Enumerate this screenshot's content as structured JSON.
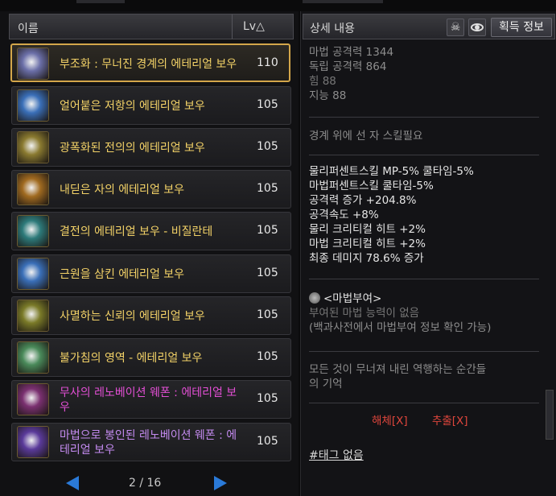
{
  "list": {
    "header_name": "이름",
    "header_lv": "Lv△",
    "items": [
      {
        "name": "부조화 : 무너진 경계의 에테리얼 보우",
        "lv": "110",
        "color": "#f3d267",
        "icon": "bow-purple-icon",
        "icon_bg": "#6b6fa8",
        "selected": true
      },
      {
        "name": "얼어붙은 저항의 에테리얼 보우",
        "lv": "105",
        "color": "#f3d267",
        "icon": "bow-blue-icon",
        "icon_bg": "#3a6fb8"
      },
      {
        "name": "광폭화된 전의의 에테리얼 보우",
        "lv": "105",
        "color": "#f3d267",
        "icon": "bow-gold-icon",
        "icon_bg": "#8a7a30"
      },
      {
        "name": "내딛은 자의 에테리얼 보우",
        "lv": "105",
        "color": "#f3d267",
        "icon": "bow-orange-icon",
        "icon_bg": "#a06a20"
      },
      {
        "name": "결전의 에테리얼 보우 - 비질란테",
        "lv": "105",
        "color": "#f3d267",
        "icon": "bow-teal-icon",
        "icon_bg": "#2d7a7a"
      },
      {
        "name": "근원을 삼킨 에테리얼 보우",
        "lv": "105",
        "color": "#f3d267",
        "icon": "bow-blue-icon",
        "icon_bg": "#3a6fb8"
      },
      {
        "name": "사멸하는 신뢰의 에테리얼 보우",
        "lv": "105",
        "color": "#f3d267",
        "icon": "bow-gold-icon",
        "icon_bg": "#7a7a28"
      },
      {
        "name": "불가침의 영역 - 에테리얼 보우",
        "lv": "105",
        "color": "#f3d267",
        "icon": "bow-green-icon",
        "icon_bg": "#4a8a5a"
      },
      {
        "name": "무사의 레노베이션 웨폰 : 에테리얼 보우",
        "lv": "105",
        "color": "#e34fd5",
        "icon": "bow-crimson-icon",
        "icon_bg": "#7a3070"
      },
      {
        "name": "마법으로 봉인된 레노베이션 웨폰 : 에테리얼 보우",
        "lv": "105",
        "color": "#c48bf0",
        "icon": "sealed-box-icon",
        "icon_bg": "#5a3a9a"
      }
    ]
  },
  "pager": {
    "text": "2 / 16"
  },
  "detail": {
    "title": "상세 내용",
    "acquire_label": "획득 정보",
    "skull_glyph": "☠",
    "stats": [
      "마법 공격력 1344",
      "독립 공격력 864",
      "힘 88",
      "지능 88"
    ],
    "requirement": "경계 위에 선 자 스킬필요",
    "options": [
      "물리퍼센트스킬 MP-5% 쿨타임-5%",
      "마법퍼센트스킬 쿨타임-5%",
      "공격력 증가 +204.8%",
      "공격속도 +8%",
      "물리 크리티컬 히트 +2%",
      "마법 크리티컬 히트 +2%",
      "최종 데미지 78.6% 증가"
    ],
    "enchant_title": "<마법부여>",
    "enchant_lines": [
      "부여된 마법 능력이 없음",
      "(백과사전에서 마법부여 정보 확인 가능)"
    ],
    "flavor": [
      "모든 것이 무너져 내린 역행하는 순간들",
      "의 기억"
    ],
    "disassemble": "해체[X]",
    "extract": "추출[X]",
    "tag_text": "#태그 없음"
  }
}
